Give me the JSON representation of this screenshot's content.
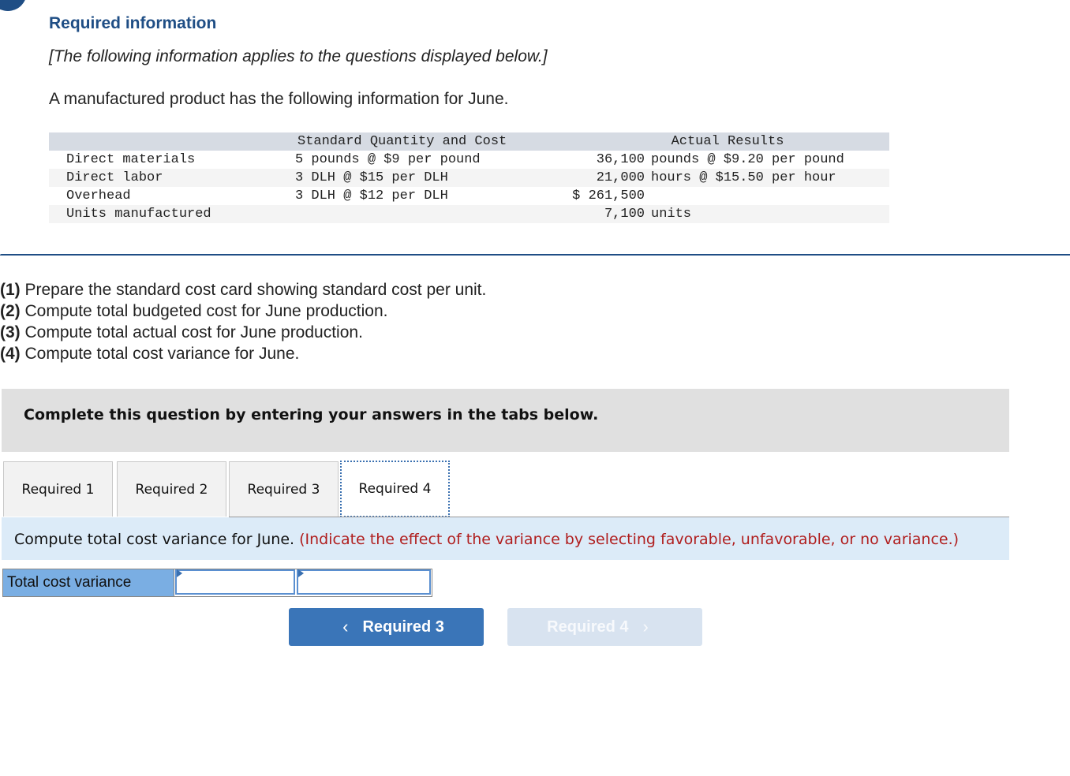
{
  "header": {
    "title": "Required information",
    "note": "[The following information applies to the questions displayed below.]",
    "intro": "A manufactured product has the following information for June."
  },
  "info_table": {
    "headers": {
      "label": "",
      "standard": "Standard Quantity and Cost",
      "actual": "Actual Results"
    },
    "rows": [
      {
        "label": "Direct materials",
        "standard": "5 pounds @ $9 per pound",
        "actual_num": "36,100",
        "actual_text": "pounds @ $9.20 per pound"
      },
      {
        "label": "Direct labor",
        "standard": "3 DLH @ $15 per DLH",
        "actual_num": "21,000",
        "actual_text": "hours @ $15.50 per hour"
      },
      {
        "label": "Overhead",
        "standard": "3 DLH @ $12 per DLH",
        "actual_num": "$ 261,500",
        "actual_text": ""
      },
      {
        "label": "Units manufactured",
        "standard": "",
        "actual_num": "7,100",
        "actual_text": "units"
      }
    ]
  },
  "questions": [
    {
      "num": "(1)",
      "text": " Prepare the standard cost card showing standard cost per unit."
    },
    {
      "num": "(2)",
      "text": " Compute total budgeted cost for June production."
    },
    {
      "num": "(3)",
      "text": " Compute total actual cost for June production."
    },
    {
      "num": "(4)",
      "text": " Compute total cost variance for June."
    }
  ],
  "instruction": "Complete this question by entering your answers in the tabs below.",
  "tabs": [
    {
      "label": "Required 1",
      "active": false
    },
    {
      "label": "Required 2",
      "active": false
    },
    {
      "label": "Required 3",
      "active": false
    },
    {
      "label": "Required 4",
      "active": true
    }
  ],
  "prompt": {
    "main": "Compute total cost variance for June.",
    "hint": "(Indicate the effect of the variance by selecting favorable, unfavorable, or no variance.)"
  },
  "answer": {
    "label": "Total cost variance",
    "amount_value": "",
    "effect_value": ""
  },
  "nav": {
    "prev_label": "Required 3",
    "next_label": "Required 4"
  },
  "colors": {
    "brand_blue": "#1f4e85",
    "button_blue": "#3a75b8",
    "hint_red": "#b01e1e",
    "prompt_bg": "#dcebf8",
    "answer_label_bg": "#7aaee3"
  }
}
